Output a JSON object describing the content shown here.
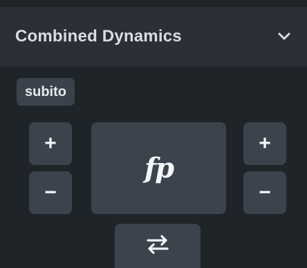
{
  "panel": {
    "title": "Combined Dynamics",
    "chevron_icon": "chevron-down-icon"
  },
  "chip": {
    "label": "subito"
  },
  "left_controls": {
    "plus_symbol": "+",
    "minus_symbol": "−"
  },
  "right_controls": {
    "plus_symbol": "+",
    "minus_symbol": "−"
  },
  "dynamic_button": {
    "label": "fp"
  },
  "swap_button": {
    "icon": "swap-arrows-icon"
  },
  "colors": {
    "background": "#1f2429",
    "header": "#2a3036",
    "button": "#3b444d",
    "text": "#f2f4f6"
  }
}
